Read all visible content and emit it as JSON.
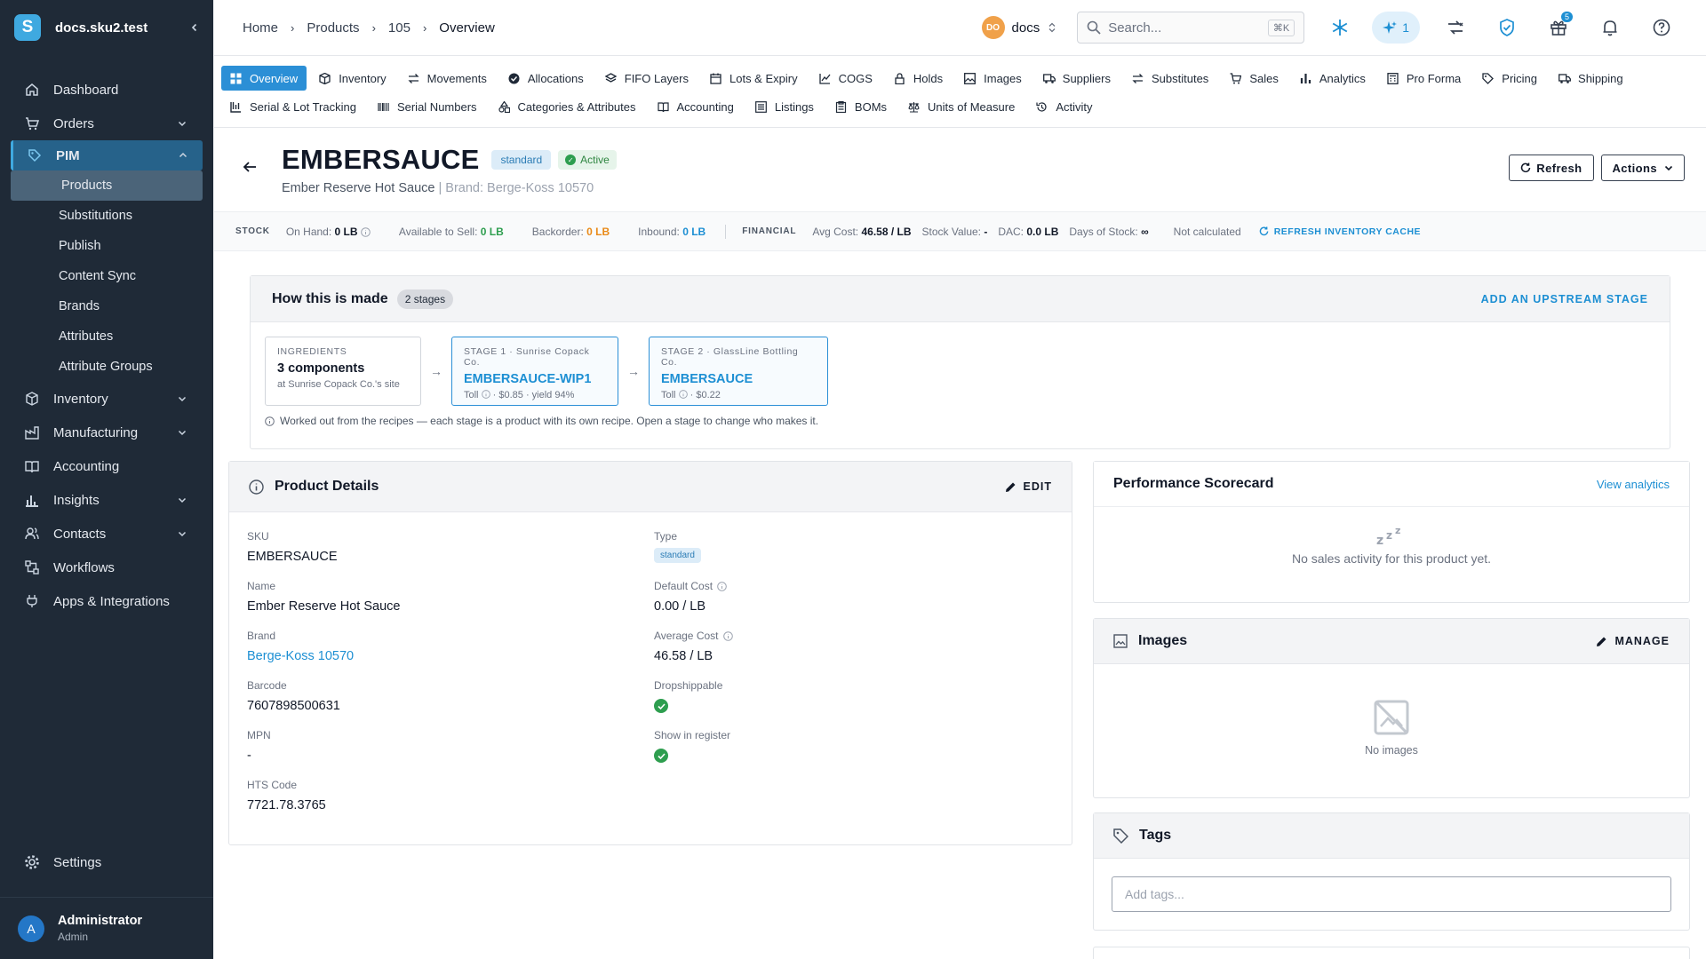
{
  "sidebar": {
    "logo_letter": "S",
    "workspace": "docs.sku2.test",
    "items": [
      {
        "label": "Dashboard"
      },
      {
        "label": "Orders"
      },
      {
        "label": "PIM"
      },
      {
        "label": "Inventory"
      },
      {
        "label": "Manufacturing"
      },
      {
        "label": "Accounting"
      },
      {
        "label": "Insights"
      },
      {
        "label": "Contacts"
      },
      {
        "label": "Workflows"
      },
      {
        "label": "Apps & Integrations"
      }
    ],
    "pim_sub": [
      "Products",
      "Substitutions",
      "Publish",
      "Content Sync",
      "Brands",
      "Attributes",
      "Attribute Groups"
    ],
    "settings": "Settings",
    "user": {
      "initial": "A",
      "name": "Administrator",
      "role": "Admin"
    }
  },
  "topbar": {
    "breadcrumb": [
      "Home",
      "Products",
      "105",
      "Overview"
    ],
    "workspace_badge": "DO",
    "workspace_name": "docs",
    "search_placeholder": "Search...",
    "search_shortcut": "⌘K",
    "ai_count": "1",
    "gift_count": "5"
  },
  "tabs": {
    "row1": [
      "Overview",
      "Inventory",
      "Movements",
      "Allocations",
      "FIFO Layers",
      "Lots & Expiry",
      "COGS",
      "Holds",
      "Images",
      "Suppliers",
      "Substitutes",
      "Sales",
      "Analytics",
      "Pro Forma",
      "Pricing",
      "Shipping"
    ],
    "row2": [
      "Serial & Lot Tracking",
      "Serial Numbers",
      "Categories & Attributes",
      "Accounting",
      "Listings",
      "BOMs",
      "Units of Measure",
      "Activity"
    ]
  },
  "product": {
    "title": "EMBERSAUCE",
    "type_chip": "standard",
    "status_chip": "Active",
    "subtitle": "Ember Reserve Hot Sauce",
    "brand_line": "| Brand: Berge-Koss 10570",
    "refresh_label": "Refresh",
    "actions_label": "Actions"
  },
  "stock": {
    "stock_label": "STOCK",
    "on_hand_label": "On Hand:",
    "on_hand": "0 LB",
    "available_label": "Available to Sell:",
    "available": "0 LB",
    "backorder_label": "Backorder:",
    "backorder": "0 LB",
    "inbound_label": "Inbound:",
    "inbound": "0 LB",
    "financial_label": "FINANCIAL",
    "avg_cost_label": "Avg Cost:",
    "avg_cost": "46.58 / LB",
    "stock_value_label": "Stock Value:",
    "stock_value": "-",
    "dac_label": "DAC:",
    "dac": "0.0 LB",
    "days_label": "Days of Stock:",
    "days": "∞",
    "not_calc": "Not calculated",
    "refresh_cache": "REFRESH INVENTORY CACHE"
  },
  "how_made": {
    "title": "How this is made",
    "badge": "2 stages",
    "add_upstream": "ADD AN UPSTREAM STAGE",
    "ingredients": {
      "label": "INGREDIENTS",
      "main": "3 components",
      "meta": "at Sunrise Copack Co.'s site"
    },
    "stage1": {
      "label": "STAGE 1 · Sunrise Copack Co.",
      "main": "EMBERSAUCE-WIP1",
      "meta_a": "Toll",
      "meta_b": "· $0.85 · yield 94%"
    },
    "stage2": {
      "label": "STAGE 2 · GlassLine Bottling Co.",
      "main": "EMBERSAUCE",
      "meta_a": "Toll",
      "meta_b": "· $0.22"
    },
    "note": "Worked out from the recipes — each stage is a product with its own recipe. Open a stage to change who makes it."
  },
  "details": {
    "title": "Product Details",
    "edit": "EDIT",
    "sku_label": "SKU",
    "sku": "EMBERSAUCE",
    "name_label": "Name",
    "name": "Ember Reserve Hot Sauce",
    "brand_label": "Brand",
    "brand": "Berge-Koss 10570",
    "barcode_label": "Barcode",
    "barcode": "7607898500631",
    "mpn_label": "MPN",
    "mpn": "-",
    "hts_label": "HTS Code",
    "hts": "7721.78.3765",
    "type_label": "Type",
    "type": "standard",
    "default_cost_label": "Default Cost",
    "default_cost": "0.00 / LB",
    "avg_cost_label": "Average Cost",
    "avg_cost": "46.58 / LB",
    "dropship_label": "Dropshippable",
    "register_label": "Show in register"
  },
  "scorecard": {
    "title": "Performance Scorecard",
    "link": "View analytics",
    "empty": "No sales activity for this product yet."
  },
  "images": {
    "title": "Images",
    "manage": "MANAGE",
    "empty": "No images"
  },
  "tags": {
    "title": "Tags",
    "placeholder": "Add tags..."
  },
  "colors": {
    "accent": "#2b8fd6",
    "sidebar": "#1f2a37",
    "success": "#2e9e4f",
    "warning": "#e98a18"
  }
}
